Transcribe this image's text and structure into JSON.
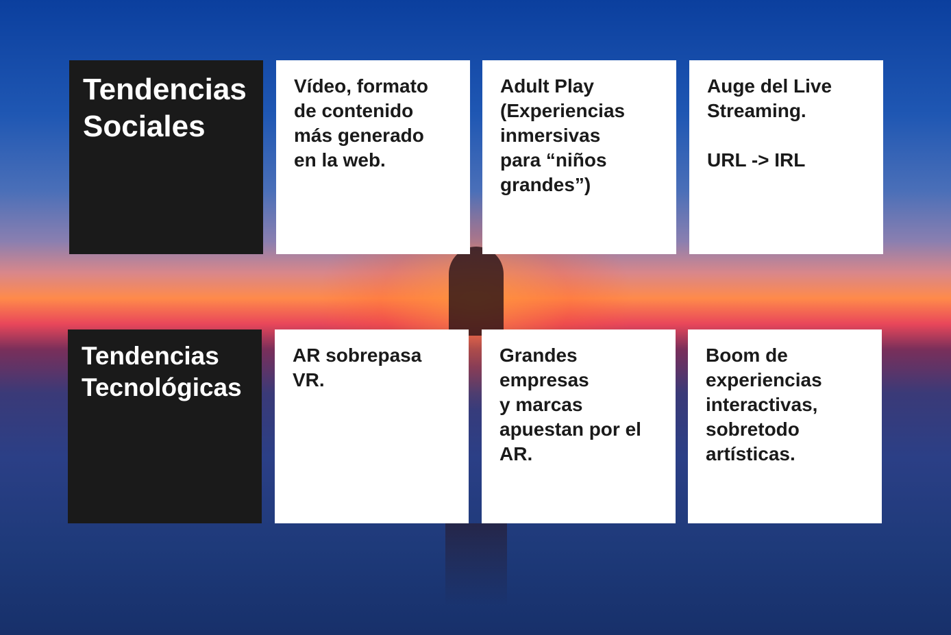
{
  "sections": [
    {
      "title_lines": [
        "Tendencias",
        "Sociales"
      ],
      "cards": [
        [
          "Vídeo, formato",
          "de contenido",
          "más generado",
          "en la web."
        ],
        [
          "Adult Play",
          "(Experiencias",
          "inmersivas",
          "para “niños",
          "grandes”)"
        ],
        [
          "Auge del Live",
          "Streaming.",
          "",
          "URL -> IRL"
        ]
      ]
    },
    {
      "title_lines": [
        "Tendencias",
        "Tecnológicas"
      ],
      "cards": [
        [
          "AR sobrepasa",
          "VR."
        ],
        [
          "Grandes",
          "empresas",
          "y marcas",
          "apuestan por el",
          "AR."
        ],
        [
          "Boom de",
          "experiencias",
          "interactivas,",
          "sobretodo",
          "artísticas."
        ]
      ]
    }
  ]
}
